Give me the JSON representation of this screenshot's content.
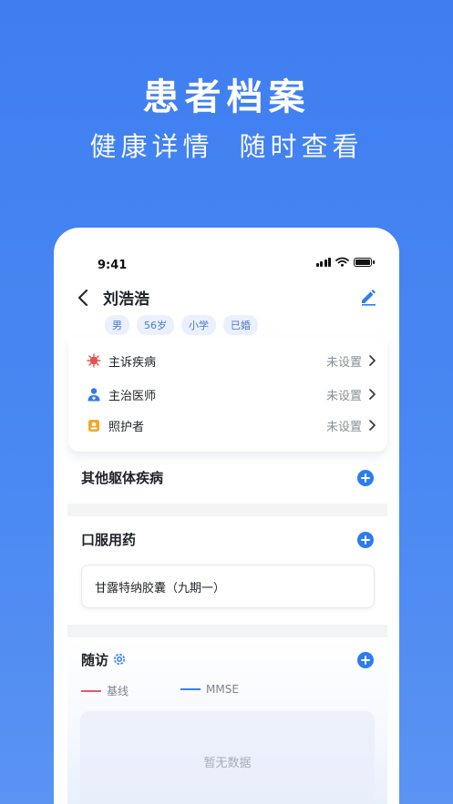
{
  "hero": {
    "title": "患者档案",
    "subtitle_left": "健康详情",
    "subtitle_right": "随时查看"
  },
  "status_bar": {
    "time": "9:41"
  },
  "patient": {
    "name": "刘浩浩",
    "tags": [
      "男",
      "56岁",
      "小学",
      "已婚"
    ]
  },
  "info_rows": [
    {
      "label": "主诉疾病",
      "value": "未设置",
      "icon": "virus-icon"
    },
    {
      "label": "主治医师",
      "value": "未设置",
      "icon": "doctor-icon"
    },
    {
      "label": "照护者",
      "value": "未设置",
      "icon": "caregiver-icon"
    }
  ],
  "sections": {
    "other_diseases": "其他躯体疾病",
    "oral_meds": "口服用药",
    "followup": "随访"
  },
  "medications": [
    "甘露特纳胶囊（九期一）"
  ],
  "legend": {
    "baseline": "基线",
    "mmse": "MMSE"
  },
  "empty_text": "暂无数据",
  "colors": {
    "accent": "#2d7cf0",
    "baseline_line": "#e65a6b",
    "mmse_line": "#3a82e8",
    "virus_icon": "#e2524f",
    "doctor_icon": "#2d7cf0",
    "caregiver_icon": "#f5a623"
  }
}
